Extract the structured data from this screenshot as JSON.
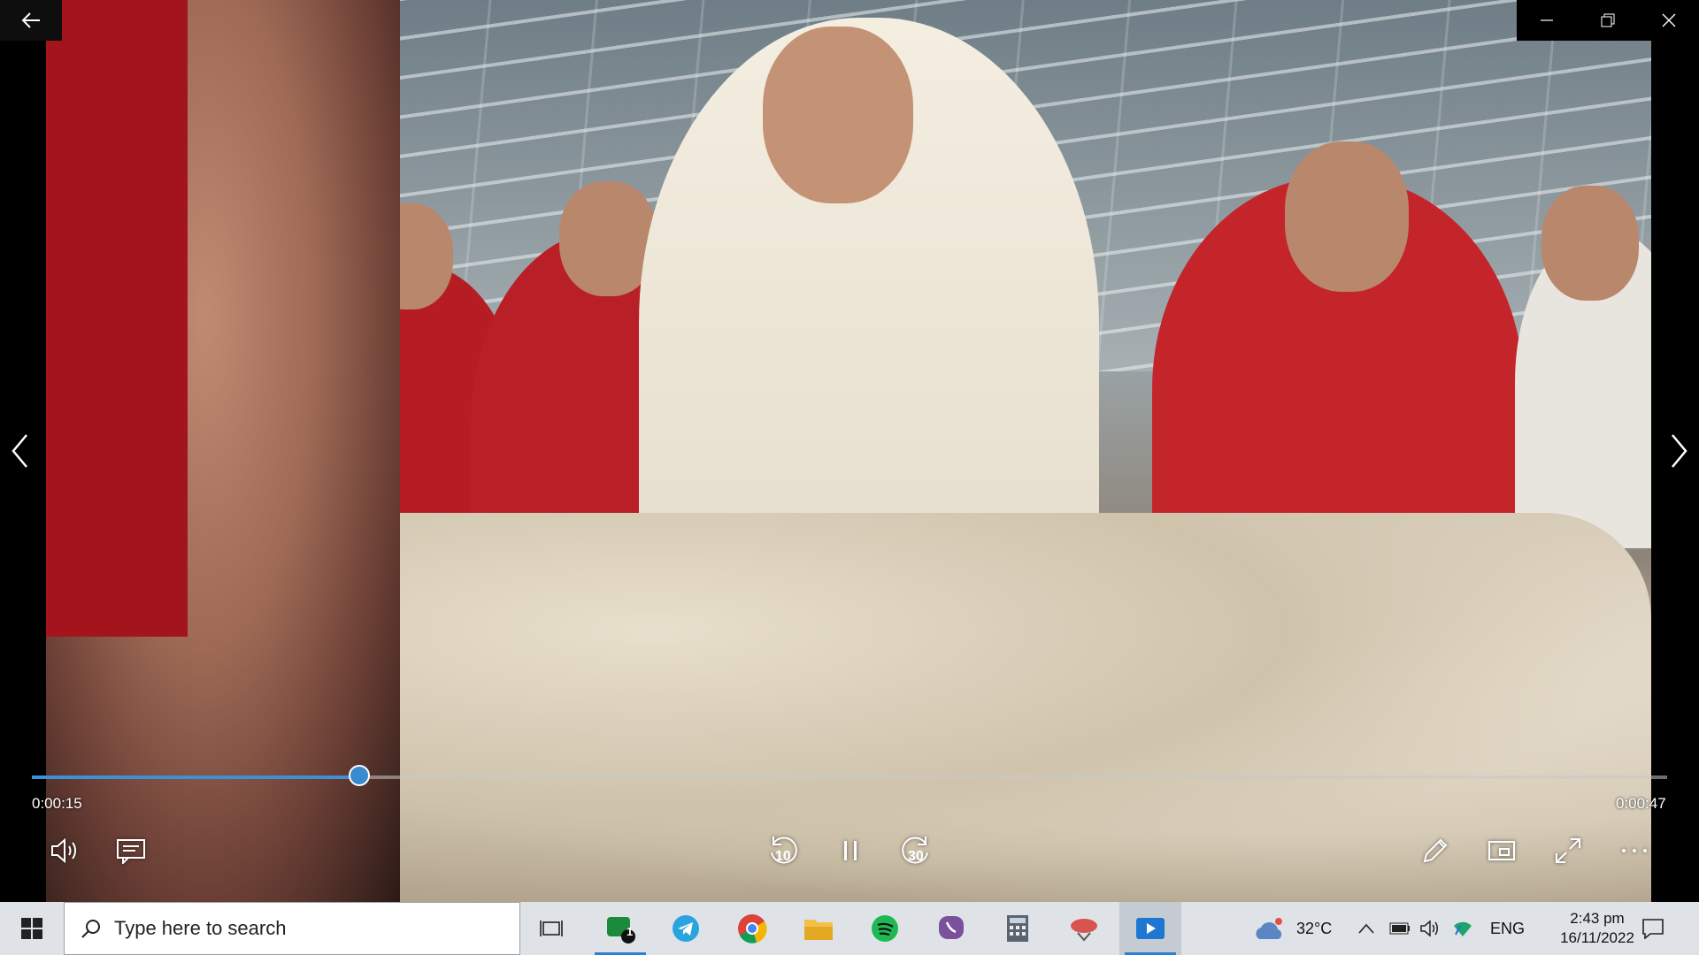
{
  "player": {
    "current_time": "0:00:15",
    "total_time": "0:00:47",
    "progress": 0.2
  },
  "controls": {
    "volume_icon": "volume-icon",
    "captions_icon": "captions-icon",
    "rewind_label": "10",
    "forward_label": "30",
    "play_pause_icon": "pause-icon",
    "edit_icon": "pencil-icon",
    "mini_view_icon": "mini-view-icon",
    "fullscreen_icon": "fullscreen-icon",
    "more_icon": "more-icon"
  },
  "window": {
    "back_icon": "back-arrow-icon",
    "minimize_icon": "minimize-icon",
    "restore_icon": "restore-icon",
    "close_icon": "close-icon"
  },
  "taskbar": {
    "search_placeholder": "Type here to search",
    "weather_temp": "32°C",
    "language": "ENG",
    "time": "2:43 pm",
    "date": "16/11/2022",
    "badge_count": "1",
    "accent": "#2d7fd3"
  }
}
